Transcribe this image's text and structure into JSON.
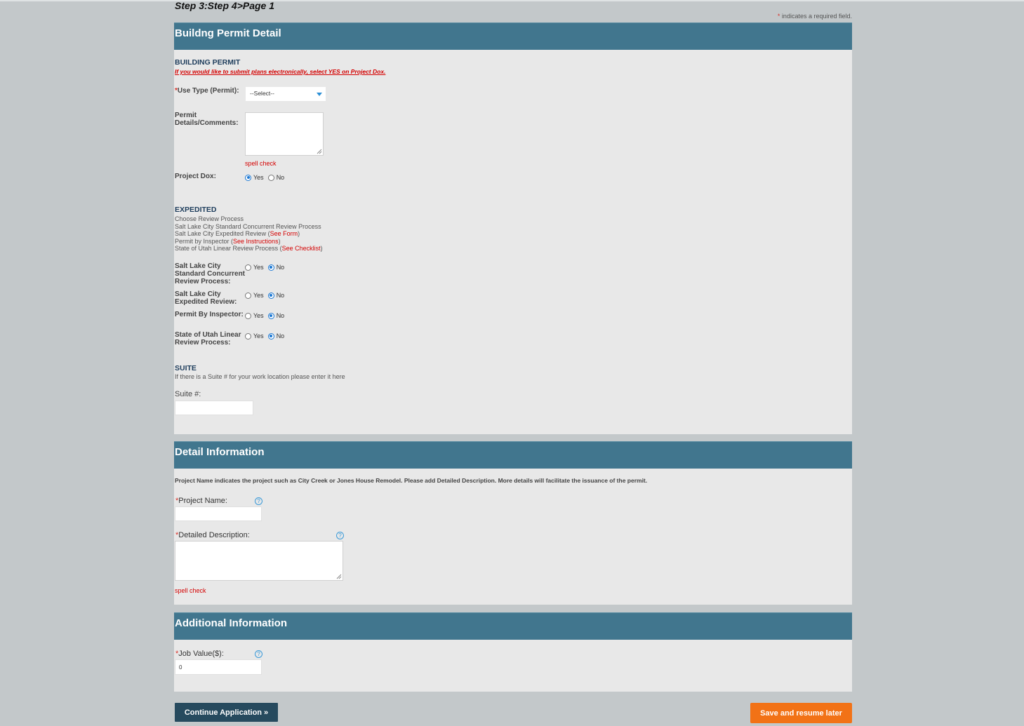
{
  "step_title": "Step 3:Step 4>Page 1",
  "required_note": "indicates a required field.",
  "required_star": "*",
  "building_permit_panel": {
    "header": "Buildng Permit Detail",
    "section_title": "BUILDING PERMIT",
    "projectdox_note": "If you would like to submit plans electronically, select YES on Project Dox.",
    "use_type_label": "Use Type (Permit):",
    "use_type_value": "--Select--",
    "permit_details_label_line1": "Permit",
    "permit_details_label_line2": "Details/Comments:",
    "spell_check": "spell check",
    "project_dox_label": "Project Dox:",
    "yes": "Yes",
    "no": "No",
    "expedited": {
      "title": "EXPEDITED",
      "line1": "Choose Review Process",
      "line2": "Salt Lake City Standard Concurrent Review Process",
      "line3": "Salt Lake City Expedited Review (",
      "line3_link": "See Form",
      "line4": "Permit by Inspector (",
      "line4_link": "See Instructions",
      "line5": "State of Utah Linear Review Process (",
      "line5_link": "See Checklist",
      "close_paren": ")",
      "q1_label": [
        "Salt Lake City",
        "Standard Concurrent",
        "Review Process:"
      ],
      "q2_label": [
        "Salt Lake City",
        "Expedited Review:"
      ],
      "q3_label": [
        "Permit By Inspector:"
      ],
      "q4_label": [
        "State of Utah Linear",
        "Review Process:"
      ]
    },
    "suite": {
      "title": "SUITE",
      "description": "If there is a Suite # for your work location please enter it here",
      "label": "Suite #:",
      "value": ""
    }
  },
  "detail_panel": {
    "header": "Detail Information",
    "description": "Project Name indicates the project such as City Creek or Jones House Remodel. Please add Detailed Description. More details will facilitate the issuance of the permit.",
    "project_name_label": "Project Name:",
    "detailed_description_label": "Detailed Description:",
    "spell_check": "spell check",
    "help": "?"
  },
  "additional_panel": {
    "header": "Additional Information",
    "job_value_label": "Job Value($):",
    "job_value": "0",
    "help": "?"
  },
  "buttons": {
    "continue": "Continue Application »",
    "save": "Save and resume later"
  },
  "colors": {
    "page_bg": "#c3c8ca",
    "panel_bg": "#e8e8e8",
    "header_bg": "#41768e",
    "continue_btn": "#264a5e",
    "save_btn": "#f27216",
    "required": "#d9342b",
    "link_red": "#d40000"
  }
}
